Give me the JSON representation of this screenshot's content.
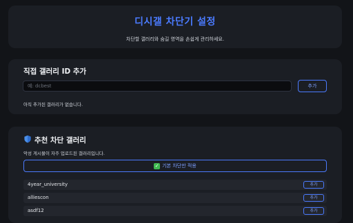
{
  "header": {
    "title": "디시갤 차단기 설정",
    "subtitle": "차단할 갤러리와 숨길 영역을 손쉽게 관리하세요."
  },
  "direct_add": {
    "section_title": "직접 갤러리 ID 추가",
    "input_placeholder": "예: dcbest",
    "input_value": "",
    "add_label": "추가",
    "empty_message": "아직 추가된 갤러리가 없습니다."
  },
  "recommended": {
    "section_title": "추천 차단 갤러리",
    "title_icon": "shield-icon",
    "description": "악성 게시물이 자주 업로드된 갤러리입니다.",
    "apply_label": "기본 차단만 적용",
    "apply_icon": "check-icon",
    "accent_color": "#4b7bff",
    "items": [
      {
        "name": "4year_university",
        "add_label": "추가"
      },
      {
        "name": "alliescon",
        "add_label": "추가"
      },
      {
        "name": "asdf12",
        "add_label": "추가"
      }
    ]
  }
}
